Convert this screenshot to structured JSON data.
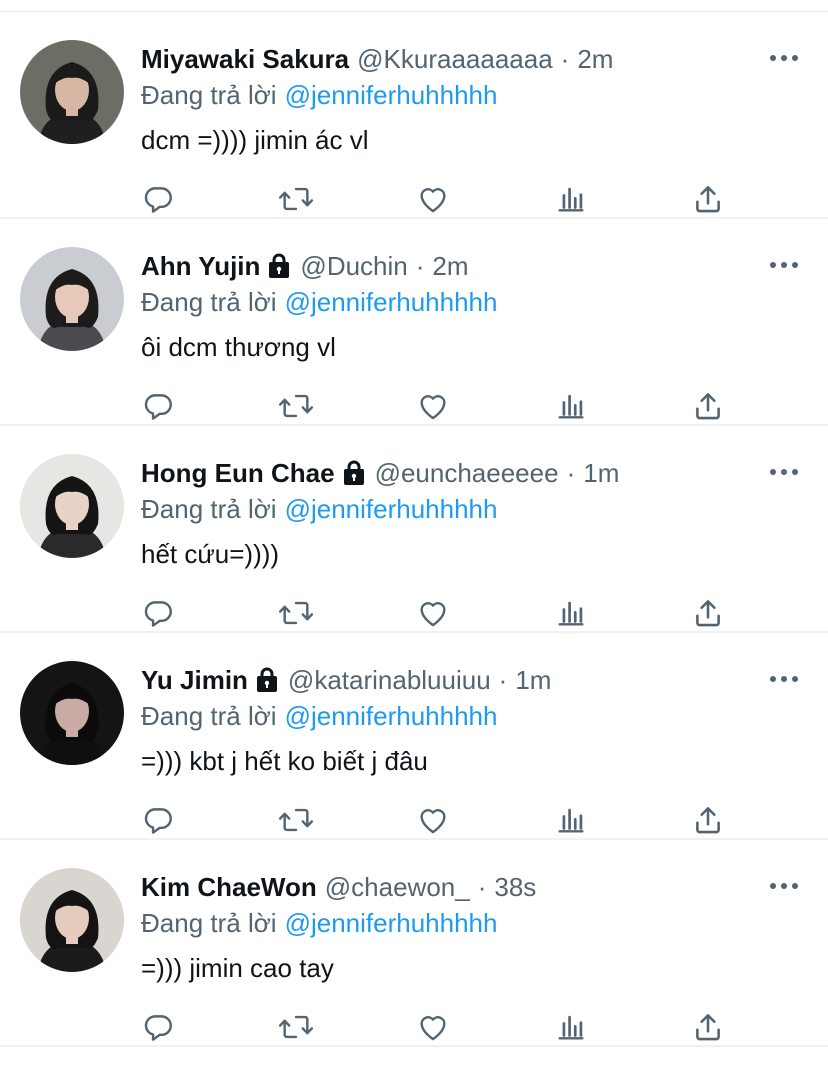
{
  "tweets": [
    {
      "name": "Miyawaki Sakura",
      "protected": false,
      "handle": "@Kkuraaaaaaaa",
      "time": "2m",
      "reply_prefix": "Đang trả lời",
      "reply_to": "@jenniferhuhhhhh",
      "text": "dcm =)))) jimin ác vl",
      "avatar_colors": {
        "bg": "#6b6e64",
        "hair": "#1b1a1a",
        "skin": "#d7b7a4",
        "shirt": "#1f1f1f"
      }
    },
    {
      "name": "Ahn Yujin",
      "protected": true,
      "handle": "@Duchin",
      "time": "2m",
      "reply_prefix": "Đang trả lời",
      "reply_to": "@jenniferhuhhhhh",
      "text": "ôi dcm thương vl",
      "avatar_colors": {
        "bg": "#c9ccd0",
        "hair": "#1d1b1c",
        "skin": "#e6c9b8",
        "shirt": "#4a4a4f"
      }
    },
    {
      "name": "Hong Eun Chae",
      "protected": true,
      "handle": "@eunchaeeeee",
      "time": "1m",
      "reply_prefix": "Đang trả lời",
      "reply_to": "@jenniferhuhhhhh",
      "text": "hết cứu=))))",
      "avatar_colors": {
        "bg": "#e8e6e2",
        "hair": "#151414",
        "skin": "#e9d3c6",
        "shirt": "#2a2a2a"
      }
    },
    {
      "name": "Yu Jimin",
      "protected": true,
      "handle": "@katarinabluuiuu",
      "time": "1m",
      "reply_prefix": "Đang trả lời",
      "reply_to": "@jenniferhuhhhhh",
      "text": "=))) kbt j hết ko biết j đâu",
      "avatar_colors": {
        "bg": "#141416",
        "hair": "#0b0b0c",
        "skin": "#c9aaa5",
        "shirt": "#101012"
      }
    },
    {
      "name": "Kim ChaeWon",
      "protected": false,
      "handle": "@chaewon_",
      "time": "38s",
      "reply_prefix": "Đang trả lời",
      "reply_to": "@jenniferhuhhhhh",
      "text": "=))) jimin cao tay",
      "avatar_colors": {
        "bg": "#d9d6d2",
        "hair": "#141213",
        "skin": "#e4cbbd",
        "shirt": "#1b1b1b"
      }
    }
  ],
  "colors": {
    "text": "#0f1419",
    "secondary": "#536471",
    "accent": "#1d9bf0",
    "divider": "#eff1f3"
  },
  "icons": [
    "reply-icon",
    "retweet-icon",
    "like-icon",
    "views-icon",
    "share-icon",
    "more-icon",
    "lock-icon"
  ]
}
